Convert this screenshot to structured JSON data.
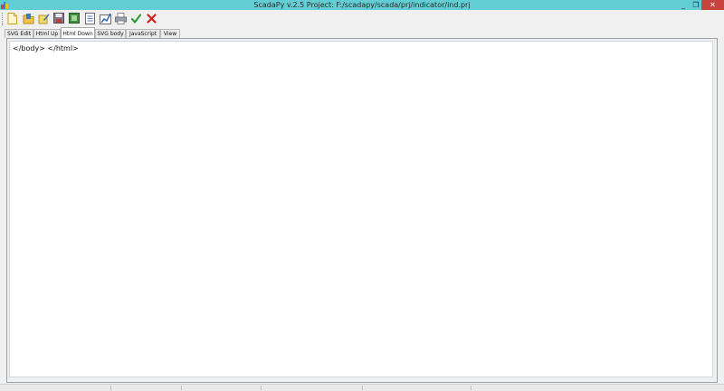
{
  "window": {
    "title": "ScadaPy v.2.5 Project: F:/scadapy/scada/prj/indicator/ind.prj",
    "minimize_glyph": "_",
    "maximize_glyph": "❐",
    "close_glyph": "✕"
  },
  "toolbar": {
    "buttons": [
      {
        "icon": "new-file-icon"
      },
      {
        "icon": "open-folder-icon"
      },
      {
        "icon": "edit-icon"
      },
      {
        "icon": "save-icon"
      },
      {
        "icon": "image-icon"
      },
      {
        "icon": "document-icon"
      },
      {
        "icon": "chart-icon"
      },
      {
        "icon": "print-icon"
      },
      {
        "icon": "checkmark-icon",
        "color": "#2e9e3a"
      },
      {
        "icon": "cancel-icon",
        "color": "#d21f1f"
      }
    ]
  },
  "tabs": [
    {
      "label": "SVG Edit"
    },
    {
      "label": "Html Up"
    },
    {
      "label": "Html Down",
      "active": true
    },
    {
      "label": "SVG body"
    },
    {
      "label": "JavaScript"
    },
    {
      "label": "View"
    }
  ],
  "editor": {
    "content": "</body> </html>"
  },
  "colors": {
    "titlebar": "#62cdd3",
    "close_button": "#c7433d"
  }
}
